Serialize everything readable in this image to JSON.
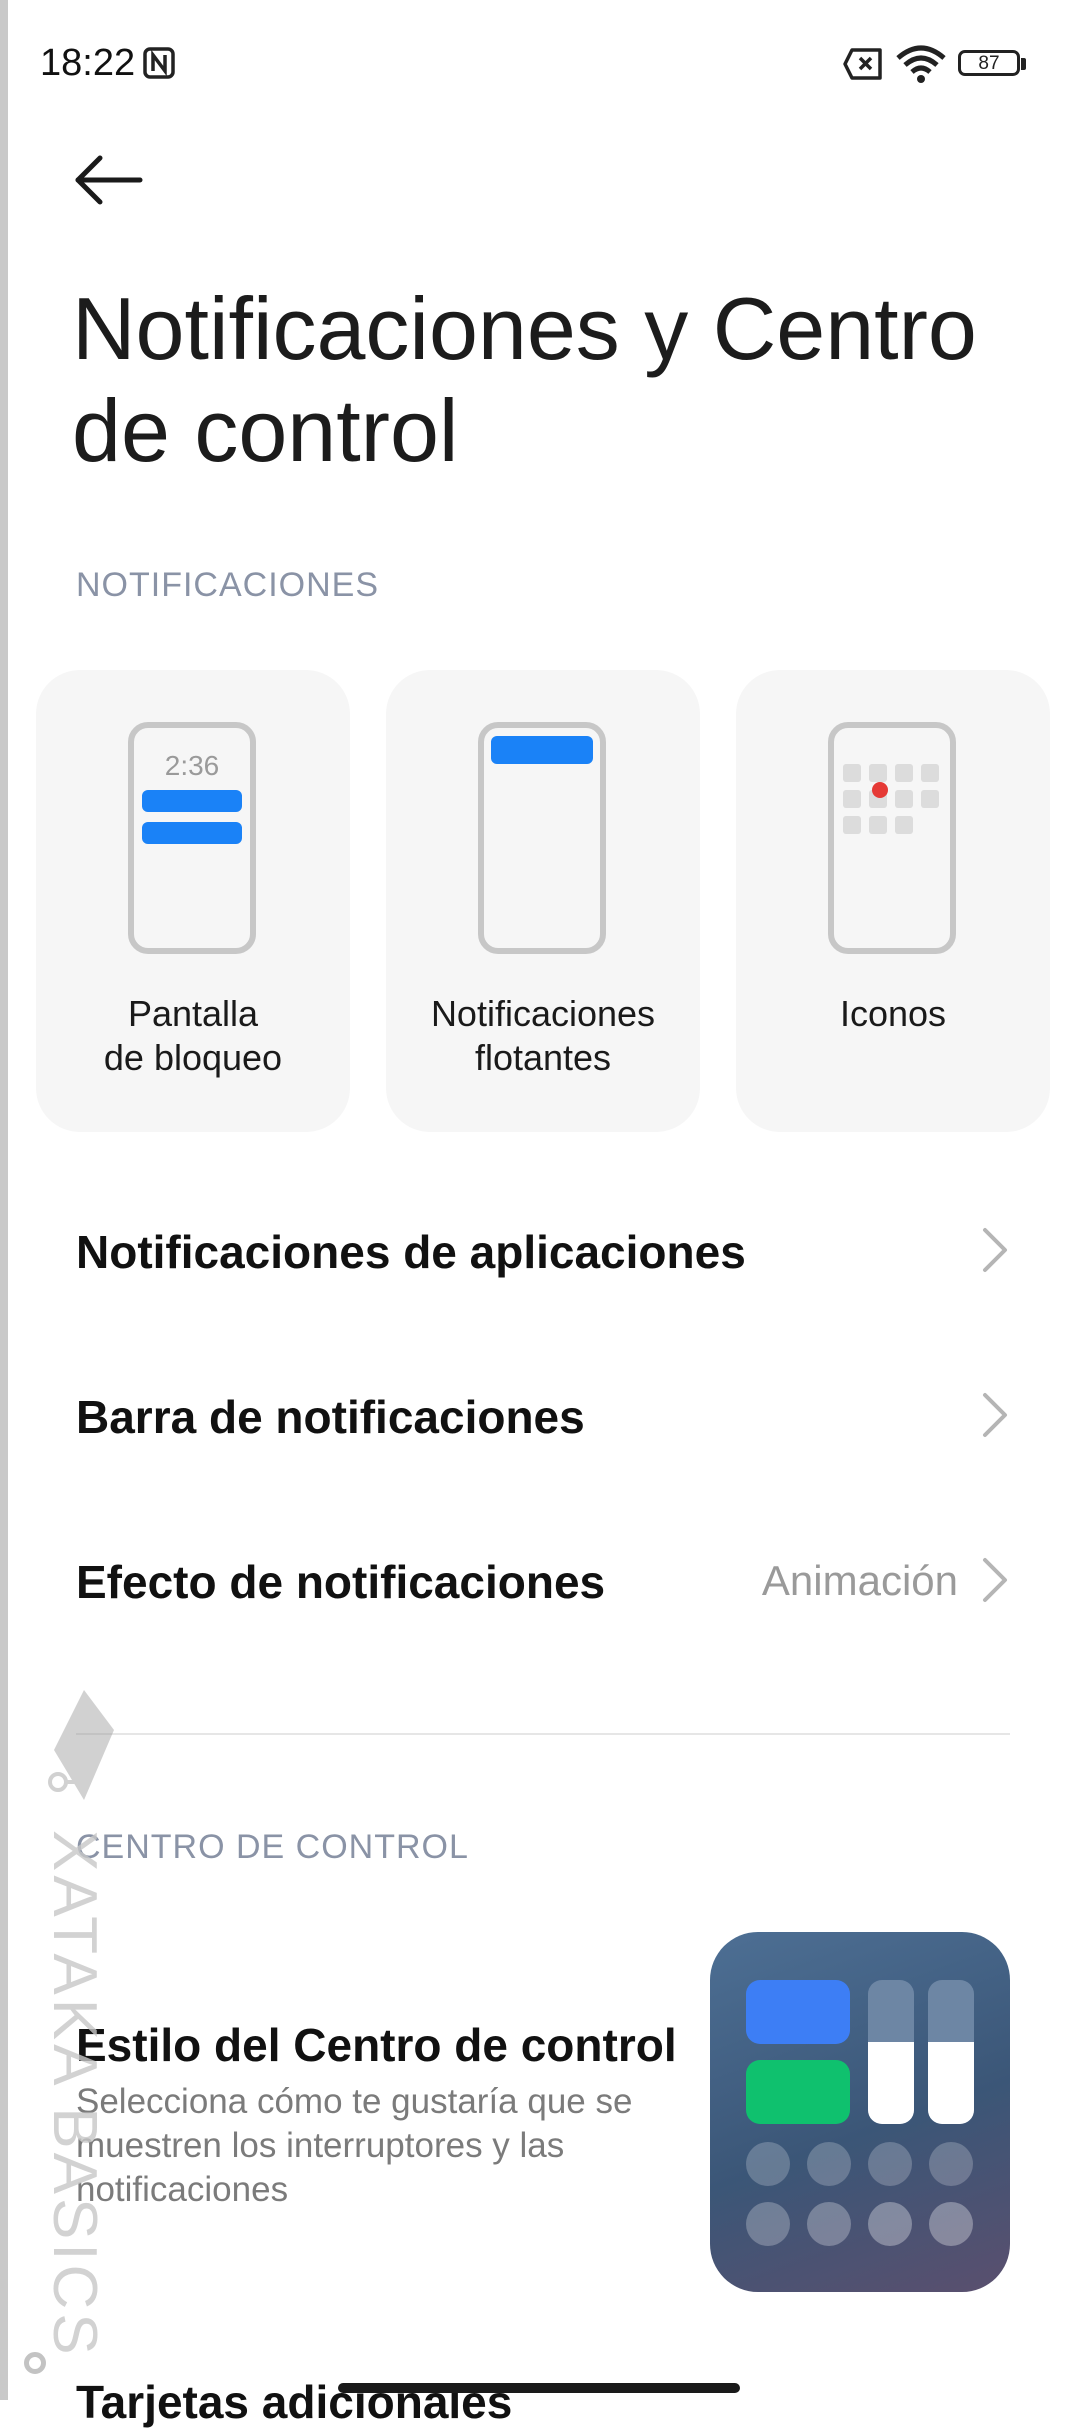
{
  "status_bar": {
    "time": "18:22",
    "battery_level": "87",
    "icons": [
      "nfc-icon",
      "sim-off-icon",
      "wifi-icon",
      "battery-icon"
    ]
  },
  "page": {
    "title": "Notificaciones y Centro de control"
  },
  "notifications_section": {
    "header": "NOTIFICACIONES",
    "cards": [
      {
        "label": "Pantalla de bloqueo",
        "preview_time": "2:36"
      },
      {
        "label": "Notificaciones flotantes"
      },
      {
        "label": "Iconos"
      }
    ],
    "rows": [
      {
        "title": "Notificaciones de aplicaciones",
        "value": ""
      },
      {
        "title": "Barra de notificaciones",
        "value": ""
      },
      {
        "title": "Efecto de notificaciones",
        "value": "Animación"
      }
    ]
  },
  "control_center_section": {
    "header": "CENTRO DE CONTROL",
    "style_title": "Estilo del Centro de control",
    "style_description": "Selecciona cómo te gustaría que se muestren los interruptores y las notificaciones",
    "next_row_title": "Tarjetas adicionales"
  },
  "watermark": {
    "text": "XATAKA BASICS"
  },
  "colors": {
    "accent_blue": "#1a82f7",
    "notification_dot": "#e53935",
    "section_header": "#8a93a6",
    "cc_tile_blue": "#3d7ef5",
    "cc_tile_green": "#0fc16e"
  }
}
